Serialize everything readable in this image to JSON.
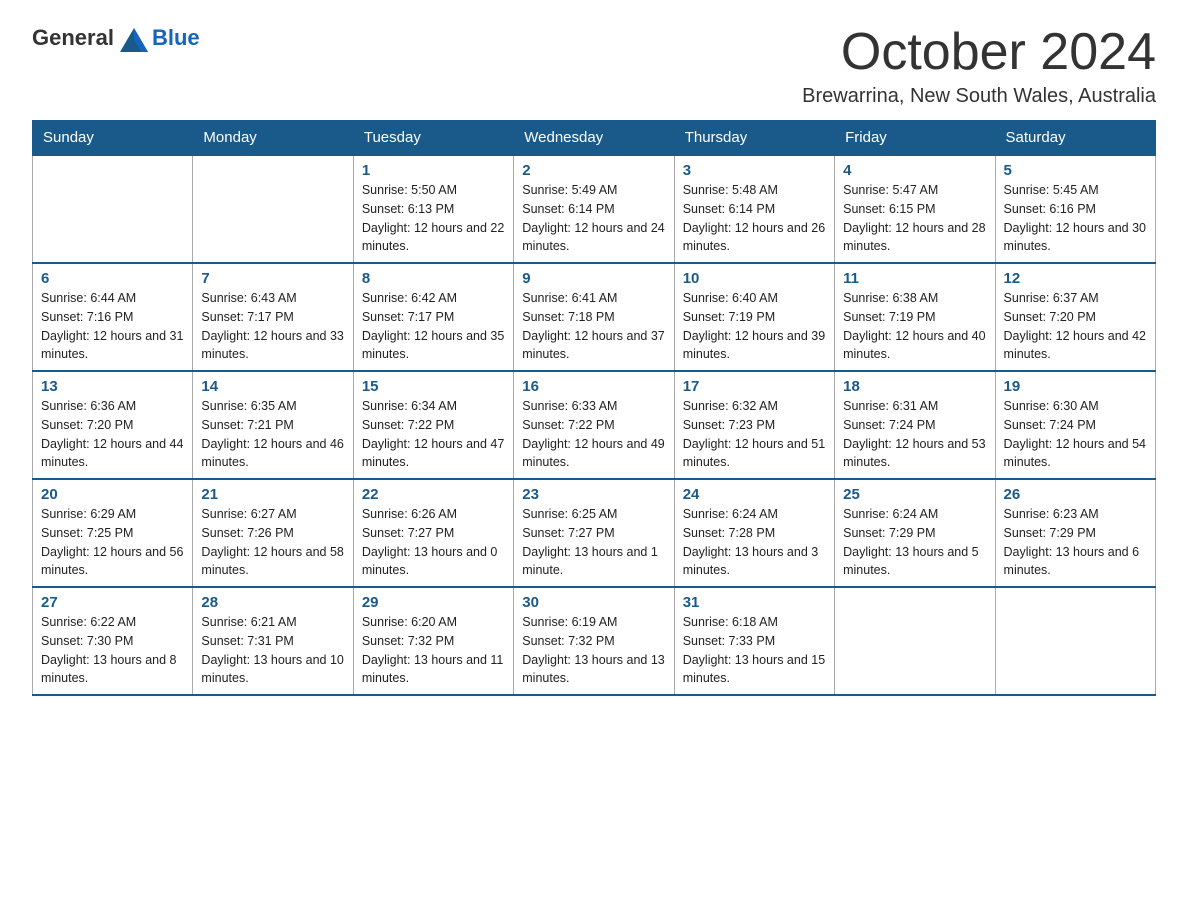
{
  "logo": {
    "general": "General",
    "blue": "Blue"
  },
  "title": "October 2024",
  "location": "Brewarrina, New South Wales, Australia",
  "weekdays": [
    "Sunday",
    "Monday",
    "Tuesday",
    "Wednesday",
    "Thursday",
    "Friday",
    "Saturday"
  ],
  "weeks": [
    [
      {
        "day": "",
        "sunrise": "",
        "sunset": "",
        "daylight": ""
      },
      {
        "day": "",
        "sunrise": "",
        "sunset": "",
        "daylight": ""
      },
      {
        "day": "1",
        "sunrise": "Sunrise: 5:50 AM",
        "sunset": "Sunset: 6:13 PM",
        "daylight": "Daylight: 12 hours and 22 minutes."
      },
      {
        "day": "2",
        "sunrise": "Sunrise: 5:49 AM",
        "sunset": "Sunset: 6:14 PM",
        "daylight": "Daylight: 12 hours and 24 minutes."
      },
      {
        "day": "3",
        "sunrise": "Sunrise: 5:48 AM",
        "sunset": "Sunset: 6:14 PM",
        "daylight": "Daylight: 12 hours and 26 minutes."
      },
      {
        "day": "4",
        "sunrise": "Sunrise: 5:47 AM",
        "sunset": "Sunset: 6:15 PM",
        "daylight": "Daylight: 12 hours and 28 minutes."
      },
      {
        "day": "5",
        "sunrise": "Sunrise: 5:45 AM",
        "sunset": "Sunset: 6:16 PM",
        "daylight": "Daylight: 12 hours and 30 minutes."
      }
    ],
    [
      {
        "day": "6",
        "sunrise": "Sunrise: 6:44 AM",
        "sunset": "Sunset: 7:16 PM",
        "daylight": "Daylight: 12 hours and 31 minutes."
      },
      {
        "day": "7",
        "sunrise": "Sunrise: 6:43 AM",
        "sunset": "Sunset: 7:17 PM",
        "daylight": "Daylight: 12 hours and 33 minutes."
      },
      {
        "day": "8",
        "sunrise": "Sunrise: 6:42 AM",
        "sunset": "Sunset: 7:17 PM",
        "daylight": "Daylight: 12 hours and 35 minutes."
      },
      {
        "day": "9",
        "sunrise": "Sunrise: 6:41 AM",
        "sunset": "Sunset: 7:18 PM",
        "daylight": "Daylight: 12 hours and 37 minutes."
      },
      {
        "day": "10",
        "sunrise": "Sunrise: 6:40 AM",
        "sunset": "Sunset: 7:19 PM",
        "daylight": "Daylight: 12 hours and 39 minutes."
      },
      {
        "day": "11",
        "sunrise": "Sunrise: 6:38 AM",
        "sunset": "Sunset: 7:19 PM",
        "daylight": "Daylight: 12 hours and 40 minutes."
      },
      {
        "day": "12",
        "sunrise": "Sunrise: 6:37 AM",
        "sunset": "Sunset: 7:20 PM",
        "daylight": "Daylight: 12 hours and 42 minutes."
      }
    ],
    [
      {
        "day": "13",
        "sunrise": "Sunrise: 6:36 AM",
        "sunset": "Sunset: 7:20 PM",
        "daylight": "Daylight: 12 hours and 44 minutes."
      },
      {
        "day": "14",
        "sunrise": "Sunrise: 6:35 AM",
        "sunset": "Sunset: 7:21 PM",
        "daylight": "Daylight: 12 hours and 46 minutes."
      },
      {
        "day": "15",
        "sunrise": "Sunrise: 6:34 AM",
        "sunset": "Sunset: 7:22 PM",
        "daylight": "Daylight: 12 hours and 47 minutes."
      },
      {
        "day": "16",
        "sunrise": "Sunrise: 6:33 AM",
        "sunset": "Sunset: 7:22 PM",
        "daylight": "Daylight: 12 hours and 49 minutes."
      },
      {
        "day": "17",
        "sunrise": "Sunrise: 6:32 AM",
        "sunset": "Sunset: 7:23 PM",
        "daylight": "Daylight: 12 hours and 51 minutes."
      },
      {
        "day": "18",
        "sunrise": "Sunrise: 6:31 AM",
        "sunset": "Sunset: 7:24 PM",
        "daylight": "Daylight: 12 hours and 53 minutes."
      },
      {
        "day": "19",
        "sunrise": "Sunrise: 6:30 AM",
        "sunset": "Sunset: 7:24 PM",
        "daylight": "Daylight: 12 hours and 54 minutes."
      }
    ],
    [
      {
        "day": "20",
        "sunrise": "Sunrise: 6:29 AM",
        "sunset": "Sunset: 7:25 PM",
        "daylight": "Daylight: 12 hours and 56 minutes."
      },
      {
        "day": "21",
        "sunrise": "Sunrise: 6:27 AM",
        "sunset": "Sunset: 7:26 PM",
        "daylight": "Daylight: 12 hours and 58 minutes."
      },
      {
        "day": "22",
        "sunrise": "Sunrise: 6:26 AM",
        "sunset": "Sunset: 7:27 PM",
        "daylight": "Daylight: 13 hours and 0 minutes."
      },
      {
        "day": "23",
        "sunrise": "Sunrise: 6:25 AM",
        "sunset": "Sunset: 7:27 PM",
        "daylight": "Daylight: 13 hours and 1 minute."
      },
      {
        "day": "24",
        "sunrise": "Sunrise: 6:24 AM",
        "sunset": "Sunset: 7:28 PM",
        "daylight": "Daylight: 13 hours and 3 minutes."
      },
      {
        "day": "25",
        "sunrise": "Sunrise: 6:24 AM",
        "sunset": "Sunset: 7:29 PM",
        "daylight": "Daylight: 13 hours and 5 minutes."
      },
      {
        "day": "26",
        "sunrise": "Sunrise: 6:23 AM",
        "sunset": "Sunset: 7:29 PM",
        "daylight": "Daylight: 13 hours and 6 minutes."
      }
    ],
    [
      {
        "day": "27",
        "sunrise": "Sunrise: 6:22 AM",
        "sunset": "Sunset: 7:30 PM",
        "daylight": "Daylight: 13 hours and 8 minutes."
      },
      {
        "day": "28",
        "sunrise": "Sunrise: 6:21 AM",
        "sunset": "Sunset: 7:31 PM",
        "daylight": "Daylight: 13 hours and 10 minutes."
      },
      {
        "day": "29",
        "sunrise": "Sunrise: 6:20 AM",
        "sunset": "Sunset: 7:32 PM",
        "daylight": "Daylight: 13 hours and 11 minutes."
      },
      {
        "day": "30",
        "sunrise": "Sunrise: 6:19 AM",
        "sunset": "Sunset: 7:32 PM",
        "daylight": "Daylight: 13 hours and 13 minutes."
      },
      {
        "day": "31",
        "sunrise": "Sunrise: 6:18 AM",
        "sunset": "Sunset: 7:33 PM",
        "daylight": "Daylight: 13 hours and 15 minutes."
      },
      {
        "day": "",
        "sunrise": "",
        "sunset": "",
        "daylight": ""
      },
      {
        "day": "",
        "sunrise": "",
        "sunset": "",
        "daylight": ""
      }
    ]
  ]
}
